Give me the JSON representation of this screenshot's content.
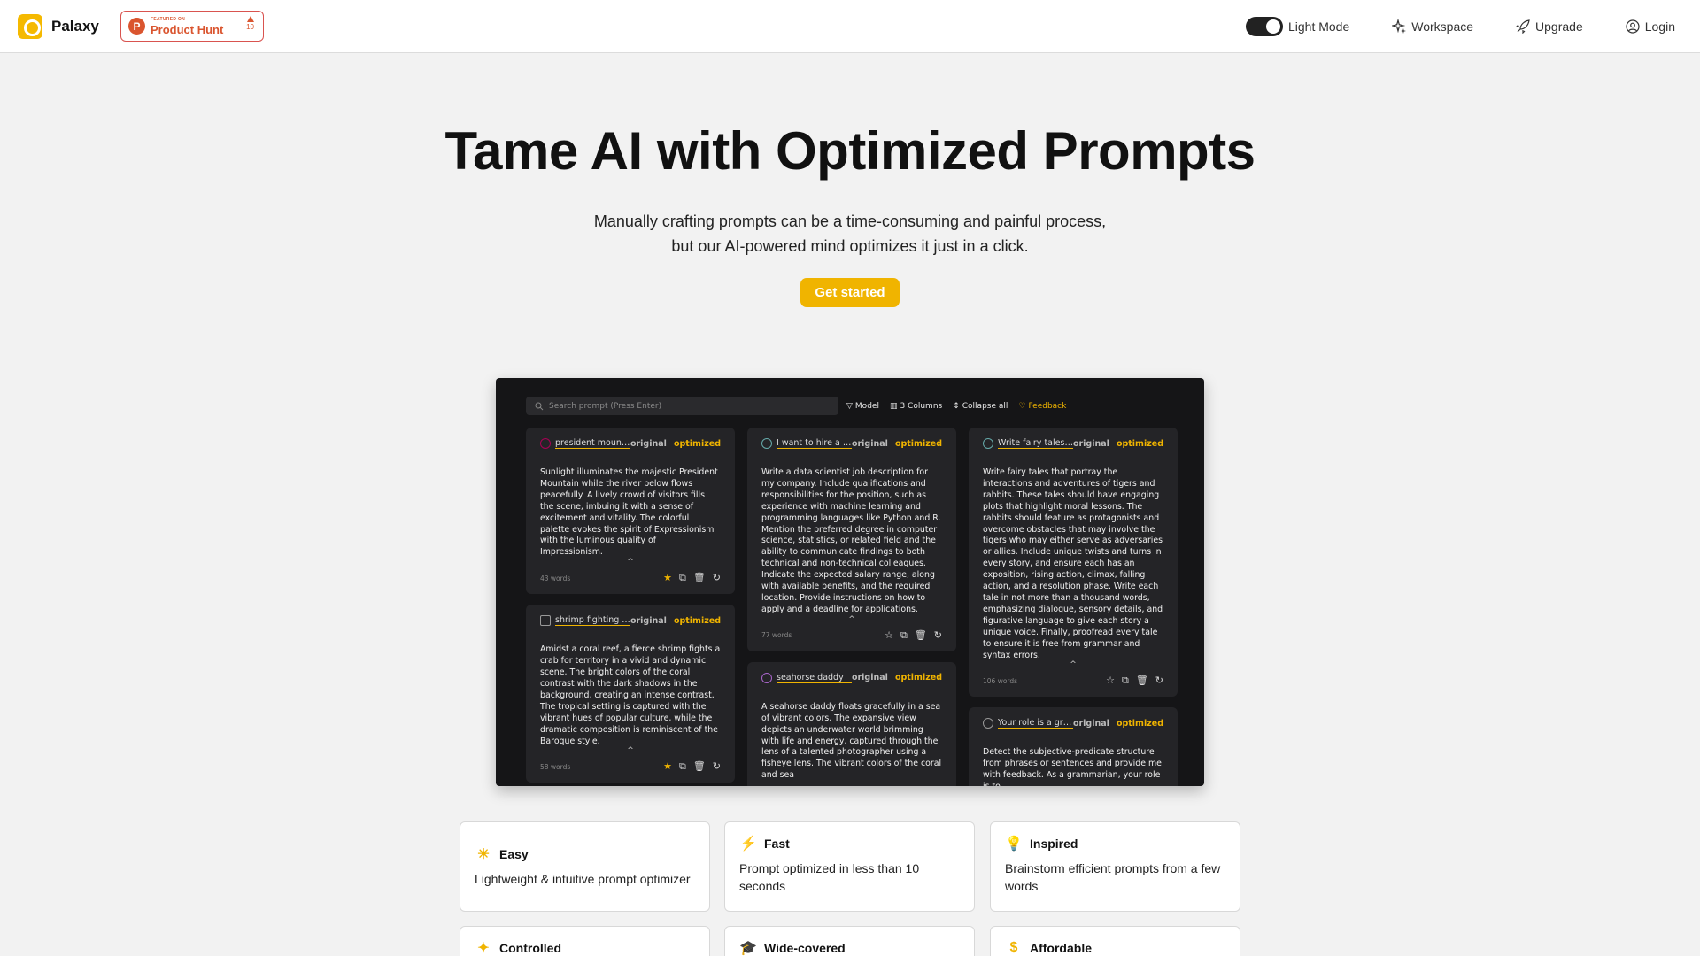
{
  "brand": {
    "name": "Palaxy",
    "accent": "#f0b400"
  },
  "badge": {
    "small": "FEATURED ON",
    "big": "Product Hunt",
    "votes": "10"
  },
  "nav": {
    "theme_label": "Light Mode",
    "workspace": "Workspace",
    "upgrade": "Upgrade",
    "login": "Login"
  },
  "hero": {
    "title": "Tame AI with Optimized Prompts",
    "sub_line1": "Manually crafting prompts can be a time-consuming and painful process,",
    "sub_line2": "but our AI-powered mind optimizes it just in a click.",
    "cta": "Get started"
  },
  "preview": {
    "search_placeholder": "Search prompt (Press Enter)",
    "tools": {
      "model": "Model",
      "columns": "3 Columns",
      "collapse": "Collapse all",
      "feedback": "Feedback"
    },
    "label_original": "original",
    "label_optimized": "optimized",
    "cards": [
      {
        "title": "president mountai...",
        "body": "Sunlight illuminates the majestic President Mountain while the river below flows peacefully. A lively crowd of visitors fills the scene, imbuing it with a sense of excitement and vitality. The colorful palette evokes the spirit of Expressionism with the luminous quality of Impressionism.",
        "words": "43 words"
      },
      {
        "title": "shrimp fighting crab",
        "body": "Amidst a coral reef, a fierce shrimp fights a crab for territory in a vivid and dynamic scene. The bright colors of the coral contrast with the dark shadows in the background, creating an intense contrast. The tropical setting is captured with the vibrant hues of popular culture, while the dramatic composition is reminiscent of the Baroque style.",
        "words": "58 words"
      },
      {
        "title": "I want to hire a da...",
        "body": "Write a data scientist job description for my company. Include qualifications and responsibilities for the position, such as experience with machine learning and programming languages like Python and R. Mention the preferred degree in computer science, statistics, or related field and the ability to communicate findings to both technical and non-technical colleagues. Indicate the expected salary range, along with available benefits, and the required location. Provide instructions on how to apply and a deadline for applications.",
        "words": "77 words"
      },
      {
        "title": "seahorse daddy",
        "body": "A seahorse daddy floats gracefully in a sea of vibrant colors. The expansive view depicts an underwater world brimming with life and energy, captured through the lens of a talented photographer using a fisheye lens. The vibrant colors of the coral and sea",
        "words": ""
      },
      {
        "title": "Write fairy tales of...",
        "body": "Write fairy tales that portray the interactions and adventures of tigers and rabbits. These tales should have engaging plots that highlight moral lessons. The rabbits should feature as protagonists and overcome obstacles that may involve the tigers who may either serve as adversaries or allies. Include unique twists and turns in every story, and ensure each has an exposition, rising action, climax, falling action, and a resolution phase. Write each tale in not more than a thousand words, emphasizing dialogue, sensory details, and figurative language to give each story a unique voice. Finally, proofread every tale to ensure it is free from grammar and syntax errors.",
        "words": "106 words"
      },
      {
        "title": "Your role is a gra...",
        "body": "Detect the subjective-predicate structure from phrases or sentences and provide me with feedback. As a grammarian, your role is to",
        "words": ""
      }
    ]
  },
  "features": [
    {
      "icon": "sun-icon",
      "glyph": "☀",
      "title": "Easy",
      "desc": "Lightweight & intuitive prompt optimizer"
    },
    {
      "icon": "bolt-icon",
      "glyph": "⚡",
      "title": "Fast",
      "desc": "Prompt optimized in less than 10 seconds"
    },
    {
      "icon": "lightbulb-icon",
      "glyph": "💡",
      "title": "Inspired",
      "desc": "Brainstorm efficient prompts from a few words"
    },
    {
      "icon": "sparkle-icon",
      "glyph": "✦",
      "title": "Controlled",
      "desc": ""
    },
    {
      "icon": "graduation-cap-icon",
      "glyph": "🎓",
      "title": "Wide-covered",
      "desc": ""
    },
    {
      "icon": "dollar-icon",
      "glyph": "$",
      "title": "Affordable",
      "desc": ""
    }
  ]
}
